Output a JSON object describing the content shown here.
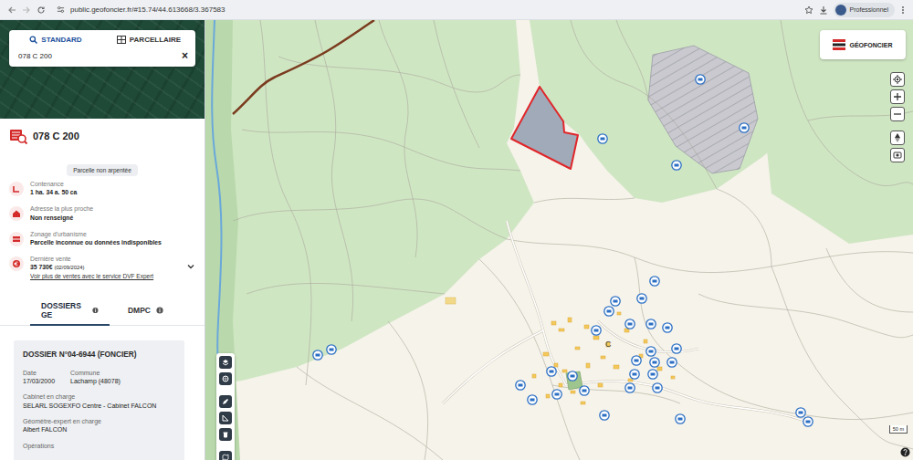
{
  "browser": {
    "url": "public.geofoncier.fr/#15.74/44.613668/3.367583",
    "profile": "Professionnel"
  },
  "search": {
    "tabs": [
      {
        "label": "STANDARD",
        "selected": true
      },
      {
        "label": "PARCELLAIRE",
        "selected": false
      }
    ],
    "value": "078 C 200",
    "clear": "×"
  },
  "parcel": {
    "title": "078 C 200",
    "badge": "Parcelle non arpentée",
    "fields": [
      {
        "label": "Contenance",
        "value": "1 ha. 34 a. 50 ca"
      },
      {
        "label": "Adresse la plus proche",
        "value": "Non renseigné"
      },
      {
        "label": "Zonage d'urbanisme",
        "value": "Parcelle inconnue ou données indisponibles"
      }
    ],
    "sale": {
      "label": "Dernière vente",
      "value": "35 730€",
      "note": "(02/09/2024)",
      "link": "Voir plus de ventes avec le service DVF Expert",
      "expanded": false
    }
  },
  "panel_tabs": [
    {
      "label": "DOSSIERS GE",
      "selected": true
    },
    {
      "label": "DMPC",
      "selected": false
    }
  ],
  "dossier": {
    "title": "DOSSIER N°04-6944 (FONCIER)",
    "fields": [
      {
        "label": "Date",
        "value": "17/03/2000"
      },
      {
        "label": "Commune",
        "value": "Lachamp (48078)"
      },
      {
        "label": "Cabinet en charge",
        "value": "SELARL SOGEXFO Centre - Cabinet FALCON"
      },
      {
        "label": "Géomètre-expert en charge",
        "value": "Albert FALCON"
      },
      {
        "label": "Opérations"
      }
    ]
  },
  "map": {
    "logo": "GÉOFONCIER",
    "scale": "50 m",
    "labels": [
      {
        "text": "C"
      }
    ]
  }
}
